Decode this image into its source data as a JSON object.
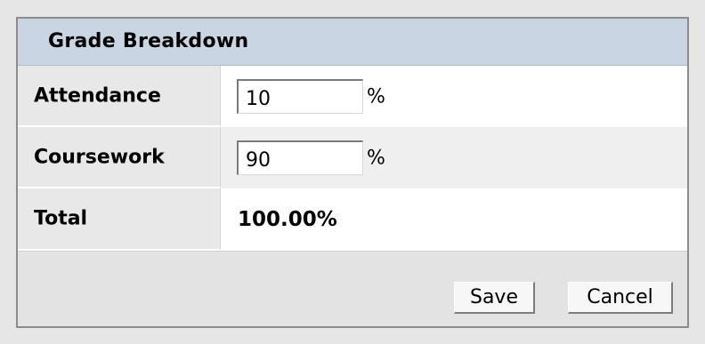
{
  "header": {
    "title": "Grade Breakdown"
  },
  "rows": [
    {
      "label": "Attendance",
      "value": "10",
      "unit": "%"
    },
    {
      "label": "Coursework",
      "value": "90",
      "unit": "%"
    }
  ],
  "total": {
    "label": "Total",
    "value": "100.00%"
  },
  "buttons": {
    "save": "Save",
    "cancel": "Cancel"
  }
}
